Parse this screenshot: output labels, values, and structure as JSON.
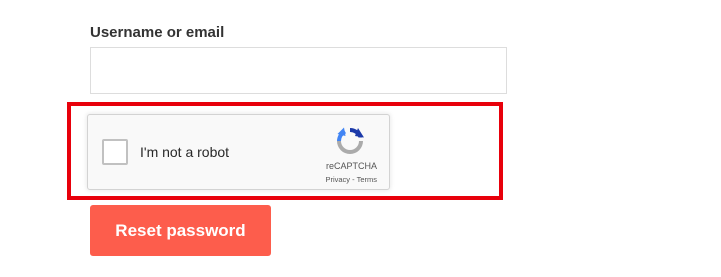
{
  "form": {
    "username_label": "Username or email",
    "username_value": "",
    "username_placeholder": ""
  },
  "recaptcha": {
    "checkbox_label": "I'm not a robot",
    "brand": "reCAPTCHA",
    "privacy_link": "Privacy",
    "separator": " - ",
    "terms_link": "Terms",
    "checked": false,
    "logo_icon": "recaptcha-logo-icon"
  },
  "highlight": {
    "color": "#e8000b"
  },
  "reset_button": {
    "label": "Reset password",
    "color": "#fd5d4c"
  }
}
